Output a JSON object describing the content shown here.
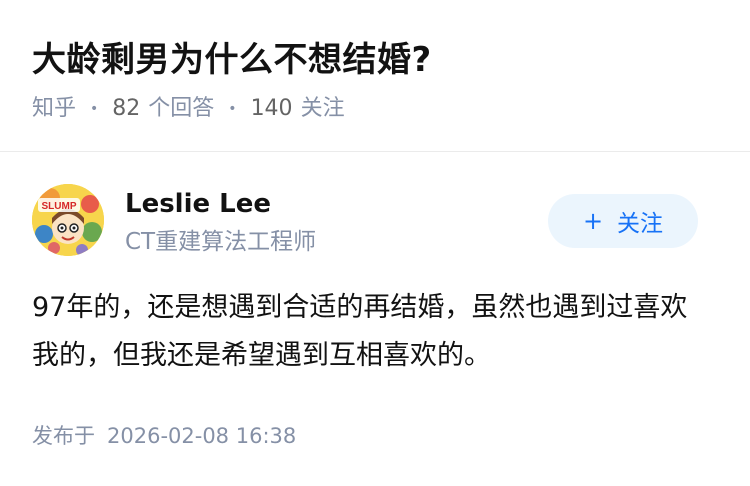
{
  "question": {
    "title": "大龄剩男为什么不想结婚?",
    "source": "知乎",
    "answer_count": "82",
    "answer_label": "个回答",
    "follower_count": "140",
    "follower_label": "关注"
  },
  "author": {
    "name": "Leslie Lee",
    "headline": "CT重建算法工程师",
    "avatar_icon": "cartoon-avatar-icon",
    "avatar_text": "SLUMP",
    "follow_label": "关注",
    "follow_icon": "plus-icon"
  },
  "answer": {
    "content": "97年的，还是想遇到合适的再结婚，虽然也遇到过喜欢我的，但我还是希望遇到互相喜欢的。",
    "published_label": "发布于",
    "published_time": "2026-02-08 16:38"
  },
  "colors": {
    "accent": "#1772f6",
    "follow_bg": "#ebf5fd",
    "muted": "#8590a6"
  }
}
